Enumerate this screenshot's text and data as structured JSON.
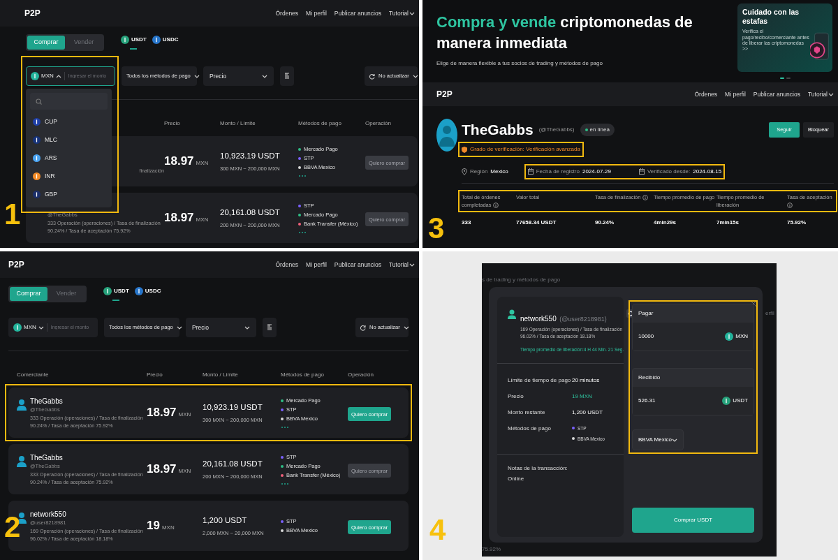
{
  "market_currency_menu": {
    "number": "1",
    "header": {
      "brand": "P2P",
      "nav": [
        {
          "label": "Órdenes"
        },
        {
          "label": "Mi perfil"
        },
        {
          "label": "Publicar anuncios"
        },
        {
          "label": "Tutorial",
          "dropdown": true
        }
      ]
    },
    "trade_tabs": [
      {
        "label": "Comprar",
        "selected": true
      },
      {
        "label": "Vender",
        "selected": false
      }
    ],
    "tokens": [
      {
        "label": "USDT",
        "selected": true,
        "color": "#26a17b"
      },
      {
        "label": "USDC",
        "selected": false,
        "color": "#2775ca"
      }
    ],
    "currency_field": {
      "currency": "MXN",
      "placeholder": "Ingresar el monto",
      "expanded": true,
      "highlighted": true
    },
    "currency_menu": [
      {
        "code": "CUP",
        "color": "#1f3fa8"
      },
      {
        "code": "MLC",
        "color": "#17337a"
      },
      {
        "code": "ARS",
        "color": "#4aa3f0"
      },
      {
        "code": "INR",
        "color": "#f28c28"
      },
      {
        "code": "GBP",
        "color": "#1c2f6b"
      }
    ],
    "payment_filter": "Todos los métodos de pago",
    "sort_filter": "Precio",
    "refresh_filter": "No actualizar",
    "columns": {
      "price": "Precio",
      "amount": "Monto / Límite",
      "methods": "Métodos de pago",
      "action": "Operación"
    },
    "rows": [
      {
        "merchant": {
          "cut_left": true,
          "stats": [
            "finalización"
          ]
        },
        "price": "18.97",
        "price_unit": "MXN",
        "amount": "10,923.19 USDT",
        "limit": "300 MXN ~ 200,000 MXN",
        "methods": [
          {
            "label": "Mercado Pago",
            "color": "#2ebd85"
          },
          {
            "label": "STP",
            "color": "#7b61ff"
          },
          {
            "label": "BBVA Mexico",
            "color": "#d9d9d9"
          }
        ],
        "has_more": true,
        "action": {
          "label": "Quiero comprar",
          "disabled": true
        },
        "highlighted": false
      },
      {
        "merchant": {
          "handle": "@TheGabbs",
          "stats": [
            "333 Operación (operaciones) / Tasa de finalización",
            "90.24% / Tasa de aceptación 75.92%"
          ]
        },
        "price": "18.97",
        "price_unit": "MXN",
        "amount": "20,161.08 USDT",
        "limit": "200 MXN ~ 200,000 MXN",
        "methods": [
          {
            "label": "STP",
            "color": "#7b61ff"
          },
          {
            "label": "Mercado Pago",
            "color": "#2ebd85"
          },
          {
            "label": "Bank Transfer (México)",
            "color": "#f0607a"
          }
        ],
        "has_more": true,
        "action": {
          "label": "Quiero comprar",
          "disabled": true
        },
        "highlighted": false
      }
    ]
  },
  "merchant_profile": {
    "number": "3",
    "hero": {
      "title_accent": "Compra y vende",
      "title": "criptomonedas de manera inmediata",
      "subtitle": "Elige de manera flexible a tus socios de trading y métodos de pago",
      "promo": {
        "title": "Cuidado con las estafas",
        "text": "Verifica el pago/recibo/comerciante antes de liberar las criptomonedas >>"
      },
      "slides": [
        {
          "selected": true
        },
        {
          "selected": false
        }
      ]
    },
    "header": {
      "brand": "P2P",
      "nav": [
        {
          "label": "Órdenes"
        },
        {
          "label": "Mi perfil"
        },
        {
          "label": "Publicar anuncios"
        },
        {
          "label": "Tutorial",
          "dropdown": true
        }
      ]
    },
    "profile": {
      "name": "TheGabbs",
      "handle": "(@TheGabbs)",
      "status": "en línea",
      "online": true,
      "actions": [
        {
          "label": "Seguir",
          "kind": "primary"
        },
        {
          "label": "Bloquear",
          "kind": "secondary"
        }
      ],
      "verification": {
        "label": "Grado de verificación:",
        "value": "Verificación avanzada",
        "highlighted": true
      },
      "region": {
        "label": "Región",
        "value": "Mexico"
      },
      "dates": [
        {
          "label": "Fecha de registro",
          "value": "2024-07-29"
        },
        {
          "label": "Verificado desde:",
          "value": "2024-08-15"
        }
      ],
      "dates_highlighted": true,
      "stats": [
        {
          "label": "Total de órdenes completadas",
          "info": true,
          "value": "333"
        },
        {
          "label": "Valor total",
          "info": false,
          "value": "77658.34 USDT"
        },
        {
          "label": "Tasa de finalización",
          "info": true,
          "value": "90.24%"
        },
        {
          "label": "Tiempo promedio de pago",
          "info": false,
          "value": "4min29s"
        },
        {
          "label": "Tiempo promedio de liberación",
          "info": false,
          "value": "7min15s"
        },
        {
          "label": "Tasa de aceptación",
          "info": true,
          "value": "75.92%"
        }
      ],
      "stats_highlighted": true
    }
  },
  "market_list": {
    "number": "2",
    "header": {
      "brand": "P2P",
      "nav": [
        {
          "label": "Órdenes"
        },
        {
          "label": "Mi perfil"
        },
        {
          "label": "Publicar anuncios"
        },
        {
          "label": "Tutorial",
          "dropdown": true
        }
      ]
    },
    "trade_tabs": [
      {
        "label": "Comprar",
        "selected": true
      },
      {
        "label": "Vender",
        "selected": false
      }
    ],
    "tokens": [
      {
        "label": "USDT",
        "selected": true,
        "color": "#26a17b"
      },
      {
        "label": "USDC",
        "selected": false,
        "color": "#2775ca"
      }
    ],
    "currency_field": {
      "currency": "MXN",
      "placeholder": "Ingresar el monto",
      "expanded": false,
      "highlighted": false
    },
    "payment_filter": "Todos los métodos de pago",
    "sort_filter": "Precio",
    "refresh_filter": "No actualizar",
    "columns": {
      "merchant": "Comerciante",
      "price": "Precio",
      "amount": "Monto / Límite",
      "methods": "Métodos de pago",
      "action": "Operación"
    },
    "rows": [
      {
        "merchant": {
          "avatar": true,
          "name": "TheGabbs",
          "handle": "@TheGabbs",
          "stats": [
            "333 Operación (operaciones) / Tasa de finalización",
            "90.24% / Tasa de aceptación 75.92%"
          ]
        },
        "price": "18.97",
        "price_unit": "MXN",
        "amount": "10,923.19 USDT",
        "limit": "300 MXN ~ 200,000 MXN",
        "methods": [
          {
            "label": "Mercado Pago",
            "color": "#2ebd85"
          },
          {
            "label": "STP",
            "color": "#7b61ff"
          },
          {
            "label": "BBVA Mexico",
            "color": "#d9d9d9"
          }
        ],
        "has_more": true,
        "action": {
          "label": "Quiero comprar",
          "disabled": false
        },
        "highlighted": true
      },
      {
        "merchant": {
          "avatar": true,
          "name": "TheGabbs",
          "handle": "@TheGabbs",
          "stats": [
            "333 Operación (operaciones) / Tasa de finalización",
            "90.24% / Tasa de aceptación 75.92%"
          ]
        },
        "price": "18.97",
        "price_unit": "MXN",
        "amount": "20,161.08 USDT",
        "limit": "200 MXN ~ 200,000 MXN",
        "methods": [
          {
            "label": "STP",
            "color": "#7b61ff"
          },
          {
            "label": "Mercado Pago",
            "color": "#2ebd85"
          },
          {
            "label": "Bank Transfer (México)",
            "color": "#f0607a"
          }
        ],
        "has_more": true,
        "action": {
          "label": "Quiero comprar",
          "disabled": true
        },
        "highlighted": false
      },
      {
        "merchant": {
          "avatar": true,
          "name": "network550",
          "handle": "@user8218981",
          "stats": [
            "169 Operación (operaciones) / Tasa de finalización",
            "96.02% / Tasa de aceptación 18.18%"
          ]
        },
        "price": "19",
        "price_unit": "MXN",
        "amount": "1,200 USDT",
        "limit": "2,000 MXN ~ 20,000 MXN",
        "methods": [
          {
            "label": "STP",
            "color": "#7b61ff"
          },
          {
            "label": "BBVA Mexico",
            "color": "#d9d9d9"
          }
        ],
        "has_more": false,
        "action": {
          "label": "Quiero comprar",
          "disabled": false
        },
        "highlighted": false
      }
    ]
  },
  "order_dialog": {
    "number": "4",
    "background_texts": [
      "s de trading y métodos de pago",
      "erfil",
      "75.92%"
    ],
    "merchant": {
      "name": "network550",
      "handle": "(@user8218981)",
      "stats": [
        "169 Operación (operaciones) / Tasa de finalización",
        "96.02% / Tasa de aceptación 18.18%"
      ],
      "release_time": "Tiempo promedio de liberación:4 H 44 Min. 21 Seg."
    },
    "details": [
      {
        "label": "Límite de tiempo de pago",
        "value": "20 minutos",
        "accent": false
      },
      {
        "label": "Precio",
        "value": "19 MXN",
        "accent": true
      },
      {
        "label": "Monto restante",
        "value": "1,200 USDT",
        "accent": false
      }
    ],
    "methods_label": "Métodos de pago",
    "methods": [
      {
        "label": "STP",
        "color": "#7b61ff"
      },
      {
        "label": "BBVA Mexico",
        "color": "#d9d9d9"
      }
    ],
    "notes_label": "Notas de la transacción:",
    "notes": "Online",
    "pay": {
      "label": "Pagar",
      "value": "10000",
      "currency": "MXN"
    },
    "receive": {
      "label": "Recibido",
      "value": "526.31",
      "currency": "USDT"
    },
    "payment_method": "BBVA Mexico",
    "submit": "Comprar USDT",
    "form_highlighted": true
  }
}
